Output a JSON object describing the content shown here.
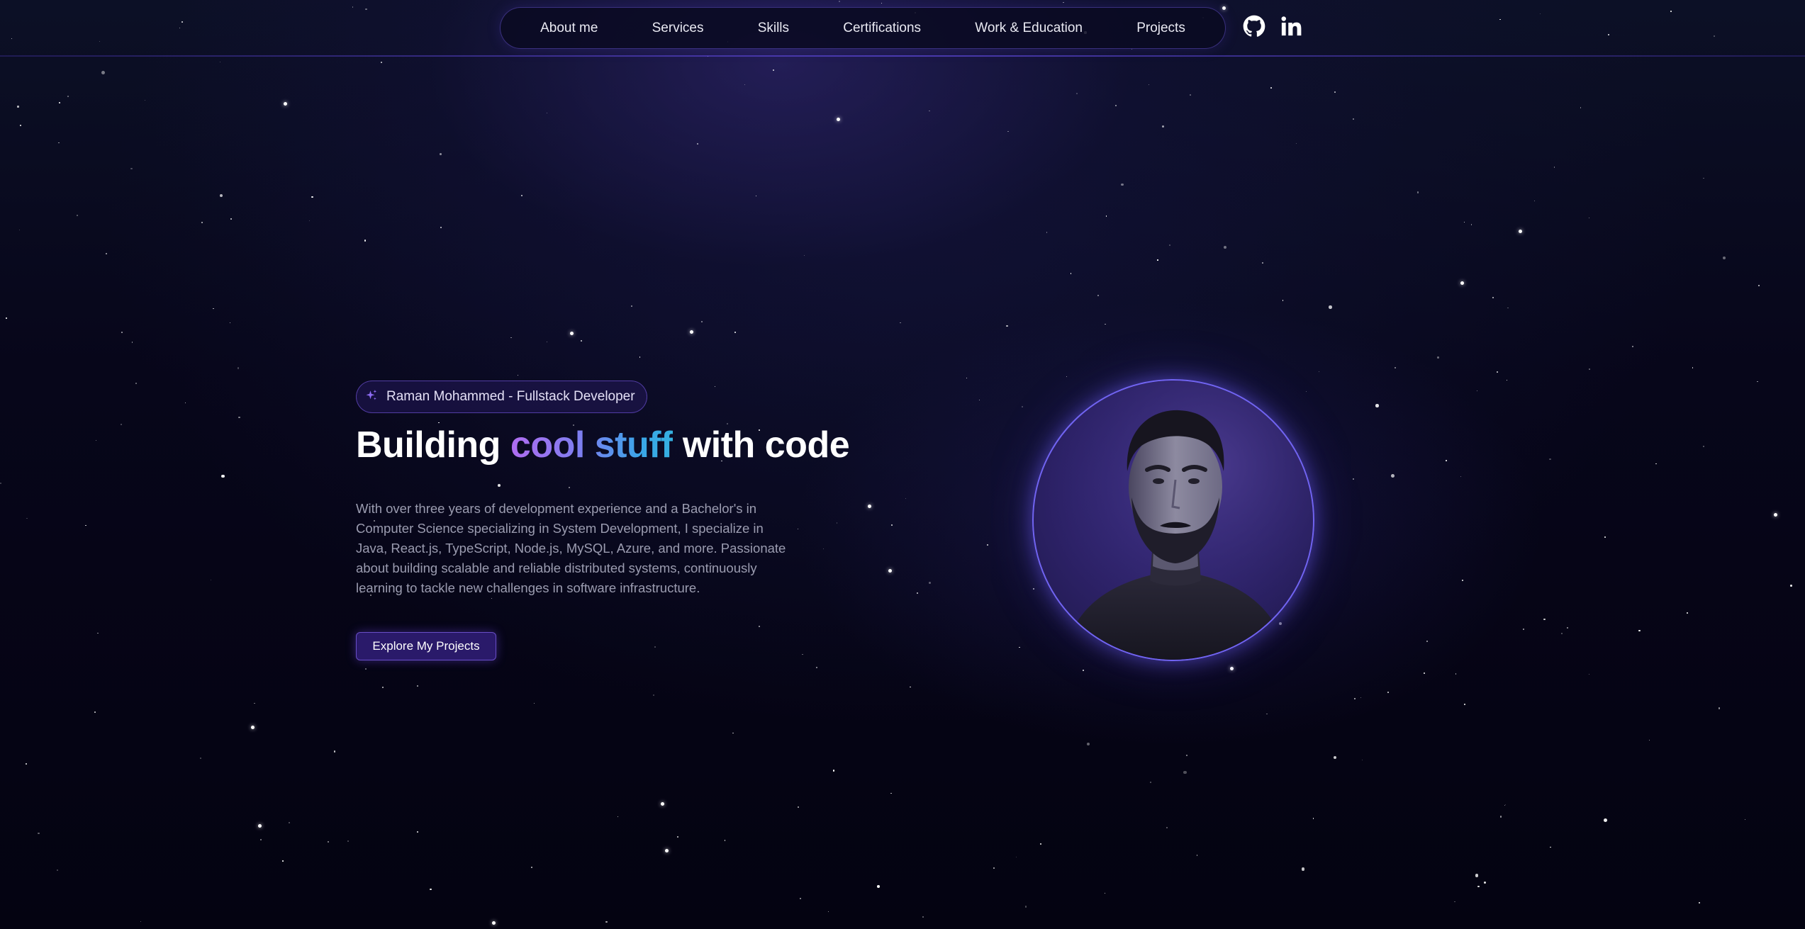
{
  "nav": {
    "items": [
      "About me",
      "Services",
      "Skills",
      "Certifications",
      "Work & Education",
      "Projects"
    ]
  },
  "social": {
    "github_icon": "github-icon",
    "linkedin_icon": "linkedin-icon"
  },
  "hero": {
    "badge_icon": "sparkles-icon",
    "badge_text": "Raman Mohammed - Fullstack Developer",
    "title_prefix": "Building ",
    "title_highlight": "cool stuff",
    "title_suffix": " with code",
    "description": "With over three years of development experience and a Bachelor's in Computer Science specializing in System Development, I specialize in Java, React.js, TypeScript, Node.js, MySQL, Azure, and more. Passionate about building scalable and reliable distributed systems, continuously learning to tackle new challenges in software infrastructure.",
    "cta_label": "Explore My Projects"
  },
  "colors": {
    "accent": "#7164f2",
    "gradient_start": "#b06cf0",
    "gradient_end": "#35b0e0",
    "background": "#050314"
  }
}
